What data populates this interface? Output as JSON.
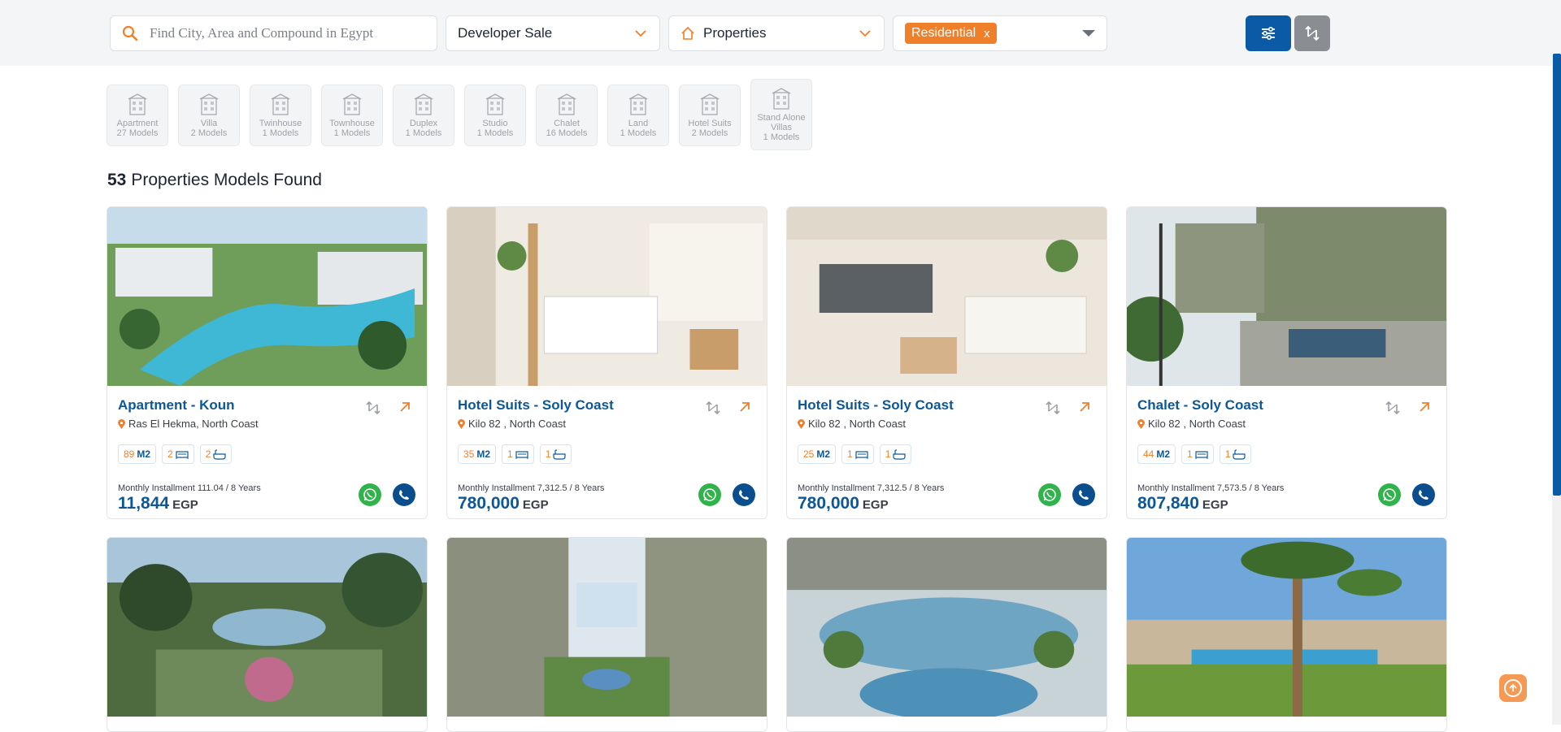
{
  "search": {
    "placeholder": "Find City, Area and Compound in Egypt"
  },
  "filters": {
    "sale_type": "Developer Sale",
    "category": "Properties",
    "type_tag": "Residential",
    "tag_remove": "x"
  },
  "categories": [
    {
      "name": "Apartment",
      "count": "27 Models",
      "icon": "apartment-icon"
    },
    {
      "name": "Villa",
      "count": "2 Models",
      "icon": "villa-icon"
    },
    {
      "name": "Twinhouse",
      "count": "1 Models",
      "icon": "twinhouse-icon"
    },
    {
      "name": "Townhouse",
      "count": "1 Models",
      "icon": "townhouse-icon"
    },
    {
      "name": "Duplex",
      "count": "1 Models",
      "icon": "duplex-icon"
    },
    {
      "name": "Studio",
      "count": "1 Models",
      "icon": "studio-icon"
    },
    {
      "name": "Chalet",
      "count": "16 Models",
      "icon": "chalet-icon"
    },
    {
      "name": "Land",
      "count": "1 Models",
      "icon": "land-icon"
    },
    {
      "name": "Hotel Suits",
      "count": "2 Models",
      "icon": "hotel-icon"
    },
    {
      "name": "Stand Alone Villas",
      "count": "1 Models",
      "icon": "standalone-villa-icon"
    }
  ],
  "results": {
    "count": "53",
    "label": "Properties Models Found"
  },
  "listings": [
    {
      "title": "Apartment - Koun",
      "location": "Ras El Hekma, North Coast",
      "area": "89",
      "area_unit": "M2",
      "beds": "2",
      "baths": "2",
      "installment": "Monthly Installment 111.04 / 8 Years",
      "price": "11,844",
      "currency": "EGP"
    },
    {
      "title": "Hotel Suits - Soly Coast",
      "location": "Kilo 82 , North Coast",
      "area": "35",
      "area_unit": "M2",
      "beds": "1",
      "baths": "1",
      "installment": "Monthly Installment 7,312.5 / 8 Years",
      "price": "780,000",
      "currency": "EGP"
    },
    {
      "title": "Hotel Suits - Soly Coast",
      "location": "Kilo 82 , North Coast",
      "area": "25",
      "area_unit": "M2",
      "beds": "1",
      "baths": "1",
      "installment": "Monthly Installment 7,312.5 / 8 Years",
      "price": "780,000",
      "currency": "EGP"
    },
    {
      "title": "Chalet - Soly Coast",
      "location": "Kilo 82 , North Coast",
      "area": "44",
      "area_unit": "M2",
      "beds": "1",
      "baths": "1",
      "installment": "Monthly Installment 7,573.5 / 8 Years",
      "price": "807,840",
      "currency": "EGP"
    }
  ],
  "colors": {
    "brand_blue": "#0a5aa6",
    "accent_orange": "#f07f2a",
    "whatsapp_green": "#2fb34a"
  }
}
